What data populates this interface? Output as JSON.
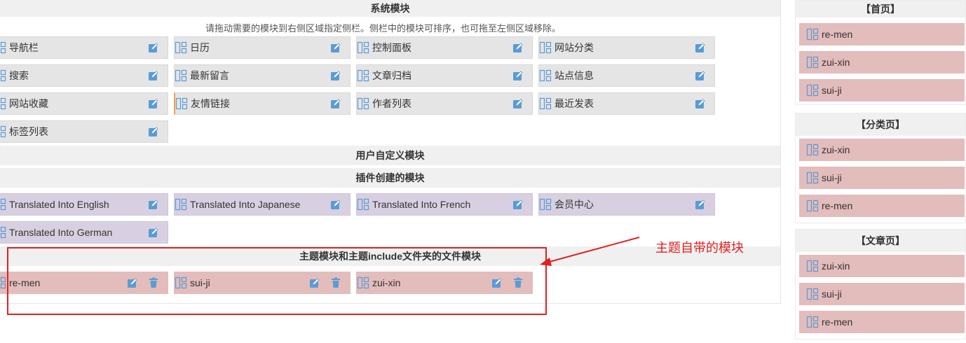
{
  "system": {
    "title": "系统模块",
    "hint": "请拖动需要的模块到右侧区域指定侧栏。侧栏中的模块可排序，也可拖至左侧区域移除。",
    "modules": [
      {
        "label": "导航栏"
      },
      {
        "label": "日历"
      },
      {
        "label": "控制面板"
      },
      {
        "label": "网站分类"
      },
      {
        "label": "搜索"
      },
      {
        "label": "最新留言"
      },
      {
        "label": "文章归档"
      },
      {
        "label": "站点信息"
      },
      {
        "label": "网站收藏"
      },
      {
        "label": "友情链接"
      },
      {
        "label": "作者列表"
      },
      {
        "label": "最近发表"
      },
      {
        "label": "标签列表"
      }
    ]
  },
  "user_defined": {
    "title": "用户自定义模块"
  },
  "plugin": {
    "title": "插件创建的模块",
    "modules": [
      {
        "label": "Translated Into English"
      },
      {
        "label": "Translated Into Japanese"
      },
      {
        "label": "Translated Into French"
      },
      {
        "label": "会员中心"
      },
      {
        "label": "Translated Into German"
      }
    ]
  },
  "theme": {
    "title": "主题模块和主题include文件夹的文件模块",
    "modules": [
      {
        "label": "re-men"
      },
      {
        "label": "sui-ji"
      },
      {
        "label": "zui-xin"
      }
    ]
  },
  "sidebars": [
    {
      "title": "【首页】",
      "items": [
        "re-men",
        "zui-xin",
        "sui-ji"
      ]
    },
    {
      "title": "【分类页】",
      "items": [
        "zui-xin",
        "sui-ji",
        "re-men"
      ]
    },
    {
      "title": "【文章页】",
      "items": [
        "zui-xin",
        "sui-ji",
        "re-men"
      ]
    }
  ],
  "annotation": {
    "text": "主题自带的模块"
  },
  "colors": {
    "icon_blue": "#5b9bd5",
    "annotation_red": "#e02020",
    "theme_pink": "#e3bcbc",
    "plugin_purple": "#d8d0e0"
  },
  "icons": {
    "module": "module-grid-icon",
    "edit": "edit-icon",
    "delete": "trash-icon"
  }
}
